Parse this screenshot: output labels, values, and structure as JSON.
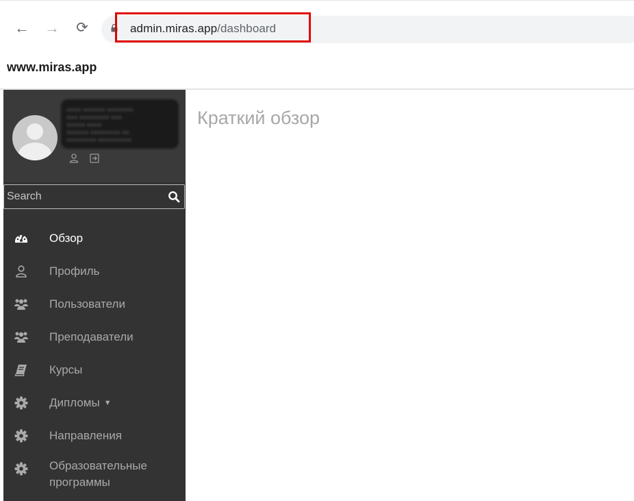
{
  "browser": {
    "url_host": "admin.miras.app",
    "url_path": "/dashboard",
    "back_icon": "arrow-left-icon",
    "forward_icon": "arrow-right-icon",
    "reload_icon": "reload-icon"
  },
  "site": {
    "brand": "www.miras.app"
  },
  "sidebar": {
    "search": {
      "placeholder": "Search",
      "icon": "search-icon"
    },
    "user_panel": {
      "name_redacted": true
    },
    "items": [
      {
        "label": "Обзор",
        "icon": "dashboard-gauge-icon",
        "active": true
      },
      {
        "label": "Профиль",
        "icon": "user-icon"
      },
      {
        "label": "Пользователи",
        "icon": "users-icon"
      },
      {
        "label": "Преподаватели",
        "icon": "users-icon"
      },
      {
        "label": "Курсы",
        "icon": "book-icon"
      },
      {
        "label": "Дипломы",
        "icon": "gear-icon",
        "dropdown": true
      },
      {
        "label": "Направления",
        "icon": "gear-icon"
      },
      {
        "label": "Образовательные программы",
        "icon": "gear-icon"
      }
    ]
  },
  "main": {
    "title": "Краткий обзор"
  },
  "colors": {
    "sidebar_bg": "#333333",
    "highlight_box": "#e00000",
    "title_text": "#a7a7a7"
  }
}
